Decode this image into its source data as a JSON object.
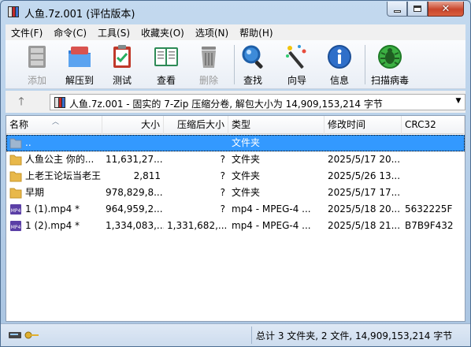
{
  "window": {
    "title": "人鱼.7z.001 (评估版本)",
    "icon": "7zip-archive-icon"
  },
  "menu": [
    {
      "label": "文件(F)"
    },
    {
      "label": "命令(C)"
    },
    {
      "label": "工具(S)"
    },
    {
      "label": "收藏夹(O)"
    },
    {
      "label": "选项(N)"
    },
    {
      "label": "帮助(H)"
    }
  ],
  "toolbar": [
    {
      "label": "添加",
      "icon": "add-archive-icon",
      "enabled": false
    },
    {
      "label": "解压到",
      "icon": "extract-folder-icon",
      "enabled": true
    },
    {
      "label": "测试",
      "icon": "test-clipboard-icon",
      "enabled": true
    },
    {
      "label": "查看",
      "icon": "view-book-icon",
      "enabled": true
    },
    {
      "label": "删除",
      "icon": "trash-icon",
      "enabled": false
    },
    {
      "label": "查找",
      "icon": "magnifier-icon",
      "enabled": true
    },
    {
      "label": "向导",
      "icon": "wizard-wand-icon",
      "enabled": true
    },
    {
      "label": "信息",
      "icon": "info-icon",
      "enabled": true
    },
    {
      "label": "扫描病毒",
      "icon": "virus-scan-icon",
      "enabled": true
    }
  ],
  "address": {
    "text": "人鱼.7z.001 - 固实的 7-Zip 压缩分卷, 解包大小为 14,909,153,214 字节",
    "up_icon": "up-arrow-icon"
  },
  "columns": {
    "name": "名称",
    "size": "大小",
    "packed": "压缩后大小",
    "type": "类型",
    "modified": "修改时间",
    "crc": "CRC32"
  },
  "rows": [
    {
      "name": "..",
      "size": "",
      "packed": "",
      "type": "文件夹",
      "modified": "",
      "crc": "",
      "icon": "parent-folder-icon",
      "selected": true
    },
    {
      "name": "人鱼公主  你的...",
      "size": "11,631,27...",
      "packed": "?",
      "type": "文件夹",
      "modified": "2025/5/17 20...",
      "crc": "",
      "icon": "folder-icon"
    },
    {
      "name": "上老王论坛当老王",
      "size": "2,811",
      "packed": "?",
      "type": "文件夹",
      "modified": "2025/5/26 13...",
      "crc": "",
      "icon": "folder-icon"
    },
    {
      "name": "早期",
      "size": "978,829,8...",
      "packed": "?",
      "type": "文件夹",
      "modified": "2025/5/17 17...",
      "crc": "",
      "icon": "folder-icon"
    },
    {
      "name": "1 (1).mp4 *",
      "size": "964,959,2...",
      "packed": "?",
      "type": "mp4 - MPEG-4 ...",
      "modified": "2025/5/18 20...",
      "crc": "5632225F",
      "icon": "mp4-file-icon"
    },
    {
      "name": "1 (2).mp4 *",
      "size": "1,334,083,...",
      "packed": "1,331,682,...",
      "type": "mp4 - MPEG-4 ...",
      "modified": "2025/5/18 21...",
      "crc": "B7B9F432",
      "icon": "mp4-file-icon"
    }
  ],
  "status": {
    "text": "总计 3 文件夹, 2 文件, 14,909,153,214 字节"
  },
  "colors": {
    "selection": "#3399ff",
    "folder": "#e8b84a",
    "close_button": "#c9462c"
  }
}
